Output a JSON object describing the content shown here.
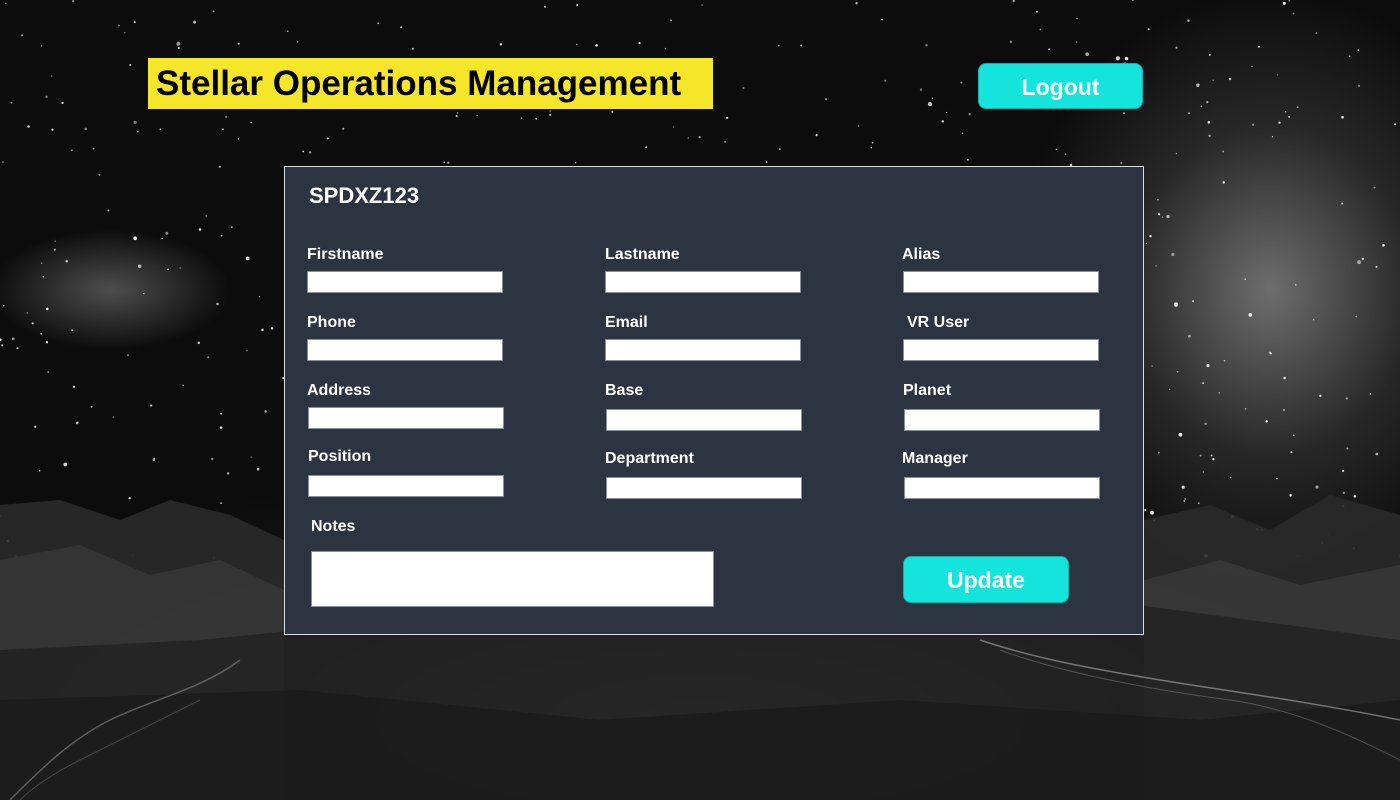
{
  "header": {
    "title": "Stellar Operations Management",
    "logout_label": "Logout"
  },
  "form": {
    "record_id": "SPDXZ123",
    "fields": {
      "firstname": {
        "label": "Firstname",
        "value": ""
      },
      "lastname": {
        "label": "Lastname",
        "value": ""
      },
      "alias": {
        "label": "Alias",
        "value": ""
      },
      "phone": {
        "label": "Phone",
        "value": ""
      },
      "email": {
        "label": "Email",
        "value": ""
      },
      "vr_user": {
        "label": "VR User",
        "value": ""
      },
      "address": {
        "label": "Address",
        "value": ""
      },
      "base": {
        "label": "Base",
        "value": ""
      },
      "planet": {
        "label": "Planet",
        "value": ""
      },
      "position": {
        "label": "Position",
        "value": ""
      },
      "department": {
        "label": "Department",
        "value": ""
      },
      "manager": {
        "label": "Manager",
        "value": ""
      },
      "notes": {
        "label": "Notes",
        "value": ""
      }
    },
    "update_label": "Update"
  },
  "colors": {
    "title_bg": "#f5e62a",
    "button_bg": "#14e4dc",
    "panel_bg": "#2d3441"
  }
}
